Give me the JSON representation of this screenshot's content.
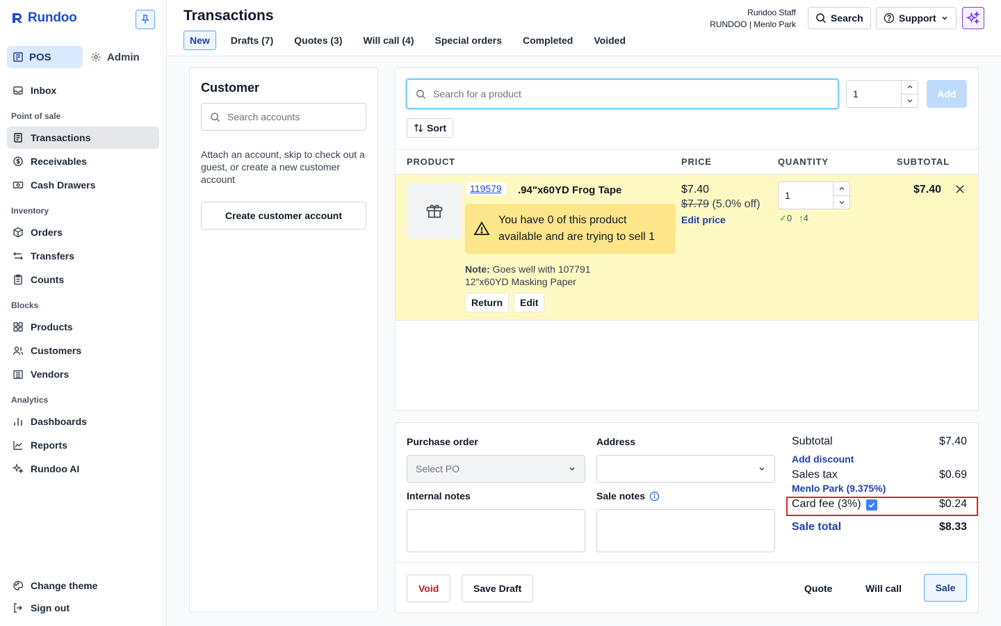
{
  "brand": {
    "name": "Rundoo",
    "accent": "#1d4ed8"
  },
  "sidebar": {
    "modes": {
      "pos": "POS",
      "admin": "Admin"
    },
    "inbox": "Inbox",
    "sections": [
      {
        "title": "Point of sale",
        "items": [
          "Transactions",
          "Receivables",
          "Cash Drawers"
        ]
      },
      {
        "title": "Inventory",
        "items": [
          "Orders",
          "Transfers",
          "Counts"
        ]
      },
      {
        "title": "Blocks",
        "items": [
          "Products",
          "Customers",
          "Vendors"
        ]
      },
      {
        "title": "Analytics",
        "items": [
          "Dashboards",
          "Reports",
          "Rundoo AI"
        ]
      }
    ],
    "footer": {
      "theme": "Change theme",
      "signout": "Sign out"
    },
    "active_item": "Transactions"
  },
  "header": {
    "title": "Transactions",
    "tabs": [
      "New",
      "Drafts (7)",
      "Quotes (3)",
      "Will call (4)",
      "Special orders",
      "Completed",
      "Voided"
    ],
    "active_tab": "New",
    "staff_name": "Rundoo Staff",
    "store": "RUNDOO | Menlo Park",
    "search_label": "Search",
    "support_label": "Support"
  },
  "customer": {
    "title": "Customer",
    "search_placeholder": "Search accounts",
    "help": "Attach an account, skip to check out a guest, or create a new customer account",
    "create_label": "Create customer account"
  },
  "products": {
    "search_placeholder": "Search for a product",
    "quantity": "1",
    "add_label": "Add",
    "sort_label": "Sort",
    "columns": {
      "product": "PRODUCT",
      "price": "PRICE",
      "quantity": "QUANTITY",
      "subtotal": "SUBTOTAL"
    },
    "line_items": [
      {
        "sku": "119579",
        "name": ".94\"x60YD Frog Tape",
        "warning": "You have 0 of this product available and are trying to sell 1",
        "note_label": "Note:",
        "note": "Goes well with 107791 12\"x60YD Masking Paper",
        "return_label": "Return",
        "edit_label": "Edit",
        "price": "$7.40",
        "original_price": "$7.79",
        "discount": "(5.0% off)",
        "edit_price_label": "Edit price",
        "quantity": "1",
        "stock_on_hand": "0",
        "stock_incoming": "4",
        "subtotal": "$7.40"
      }
    ],
    "row_highlight_color": "#fef9c3",
    "warning_color": "#fde68a"
  },
  "checkout": {
    "po_label": "Purchase order",
    "po_placeholder": "Select PO",
    "address_label": "Address",
    "internal_notes_label": "Internal notes",
    "sale_notes_label": "Sale notes",
    "subtotal_label": "Subtotal",
    "subtotal": "$7.40",
    "add_discount_label": "Add discount",
    "tax_label": "Sales tax",
    "tax_location": "Menlo Park (9.375%)",
    "tax": "$0.69",
    "card_fee_label": "Card fee (3%)",
    "card_fee_checked": true,
    "card_fee": "$0.24",
    "total_label": "Sale total",
    "total": "$8.33",
    "actions": {
      "void": "Void",
      "save_draft": "Save Draft",
      "quote": "Quote",
      "will_call": "Will call",
      "sale": "Sale"
    }
  }
}
